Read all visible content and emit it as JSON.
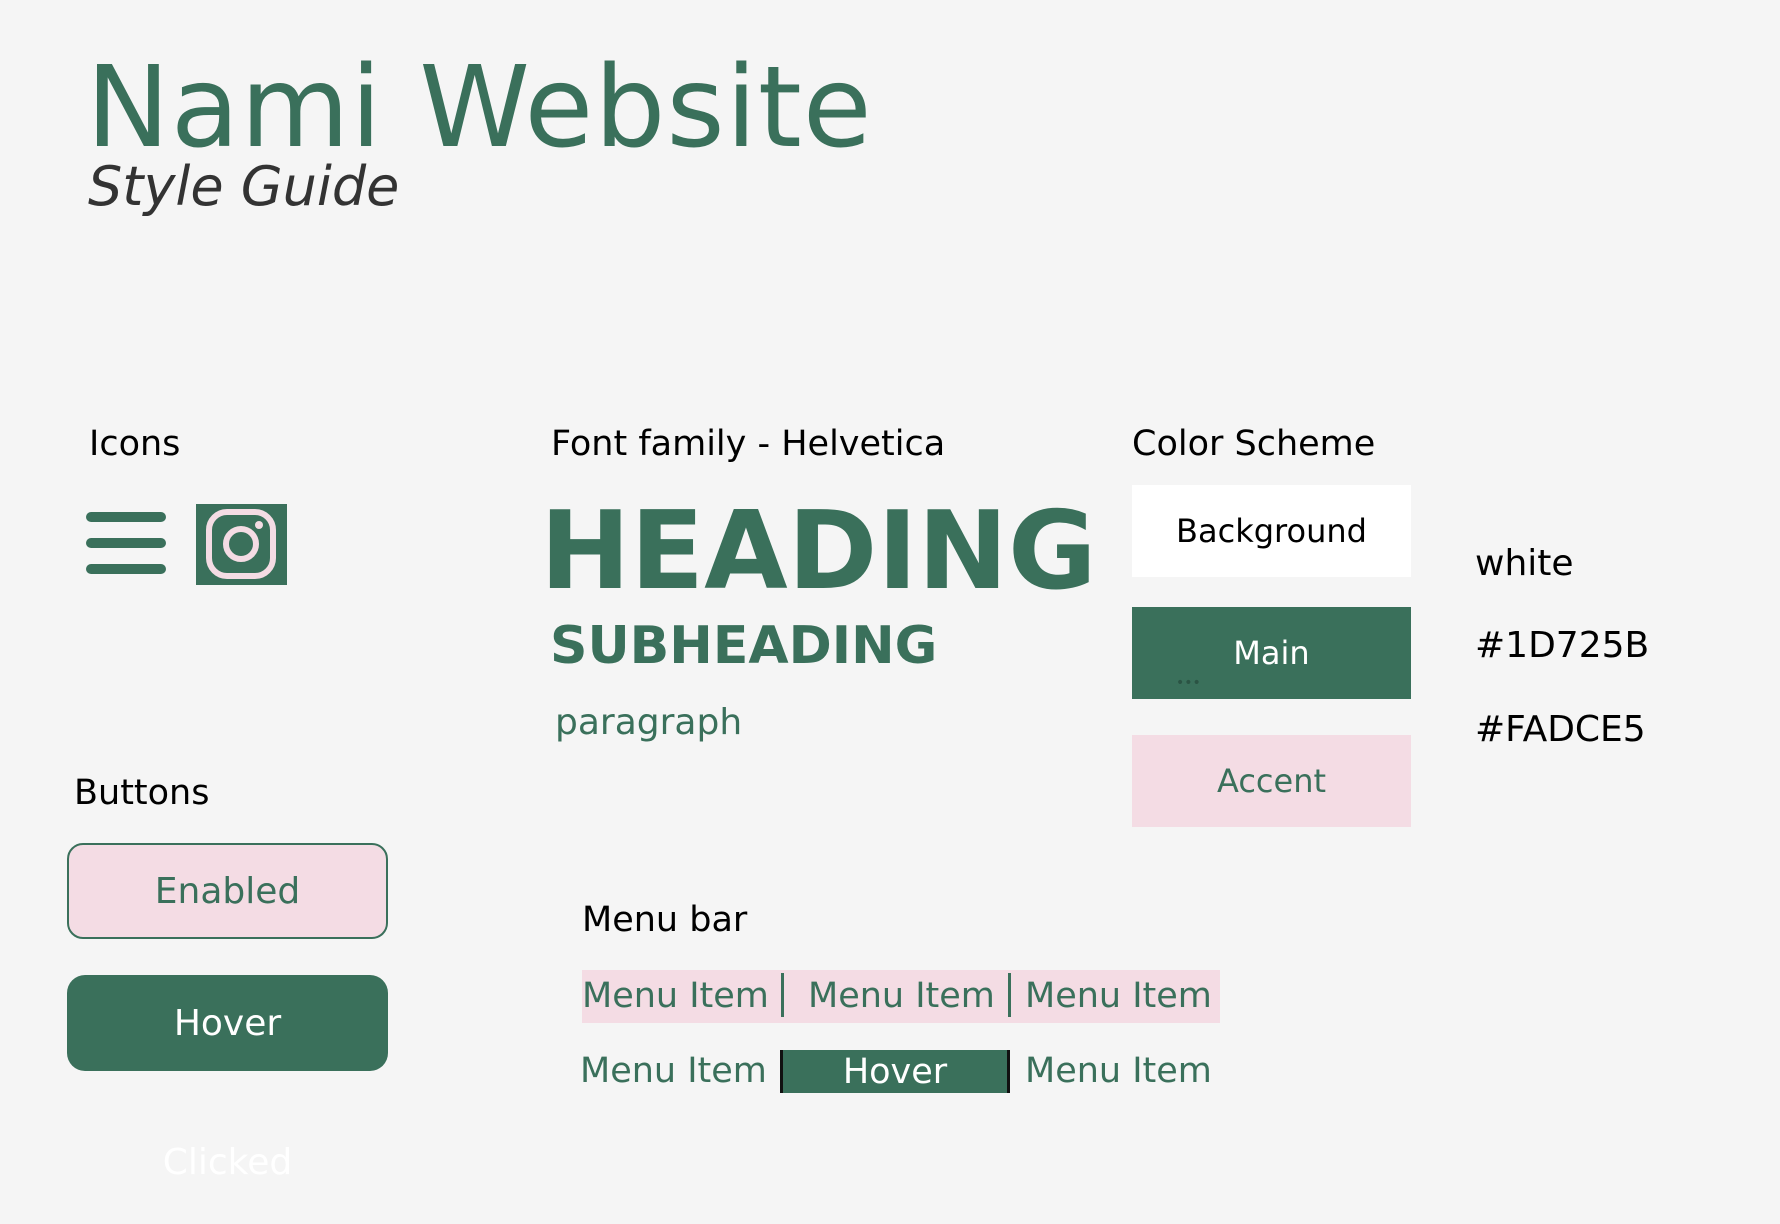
{
  "header": {
    "title": "Nami Website",
    "subtitle": "Style Guide"
  },
  "sections": {
    "icons_label": "Icons",
    "font_label": "Font family - Helvetica",
    "color_label": "Color Scheme",
    "buttons_label": "Buttons",
    "menu_label": "Menu bar"
  },
  "icons": [
    "hamburger-menu-icon",
    "instagram-icon"
  ],
  "typography": {
    "heading": "HEADING",
    "subheading": "SUBHEADING",
    "paragraph": "paragraph"
  },
  "colors": [
    {
      "name": "Background",
      "value": "white",
      "hex": "#FFFFFF"
    },
    {
      "name": "Main",
      "value": "#1D725B",
      "hex": "#3A705B"
    },
    {
      "name": "Accent",
      "value": "#FADCE5",
      "hex": "#F4DCE4"
    }
  ],
  "buttons": {
    "enabled": "Enabled",
    "hover": "Hover",
    "clicked": "Clicked"
  },
  "menu": {
    "row1": [
      "Menu Item",
      "Menu Item",
      "Menu Item"
    ],
    "row2": [
      "Menu Item",
      "Hover",
      "Menu Item"
    ]
  }
}
